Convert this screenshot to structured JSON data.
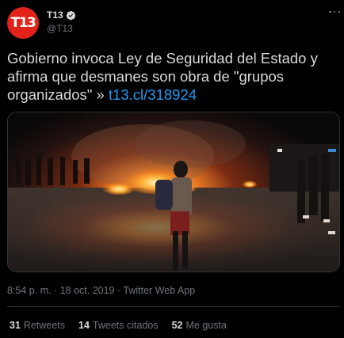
{
  "author": {
    "display_name": "T13",
    "handle": "@T13",
    "avatar_text": "T13",
    "verified": true
  },
  "tweet": {
    "text_before_link": "Gobierno invoca Ley de Seguridad del Estado y afirma que desmanes son obra de \"grupos organizados\" » ",
    "link_text": "t13.cl/318924"
  },
  "meta": {
    "time": "8:54 p. m.",
    "date": "18 oct. 2019",
    "source": "Twitter Web App",
    "separator": " · "
  },
  "stats": {
    "retweets_count": "31",
    "retweets_label": "Retweets",
    "quotes_count": "14",
    "quotes_label": "Tweets citados",
    "likes_count": "52",
    "likes_label": "Me gusta"
  },
  "icons": {
    "verified": "verified-badge-icon",
    "more": "more-options-icon"
  },
  "colors": {
    "background": "#000000",
    "text": "#d9d9d9",
    "secondary": "#6e767d",
    "link": "#1d9bf0",
    "avatar_bg": "#e2231a",
    "divider": "#2f3336"
  }
}
